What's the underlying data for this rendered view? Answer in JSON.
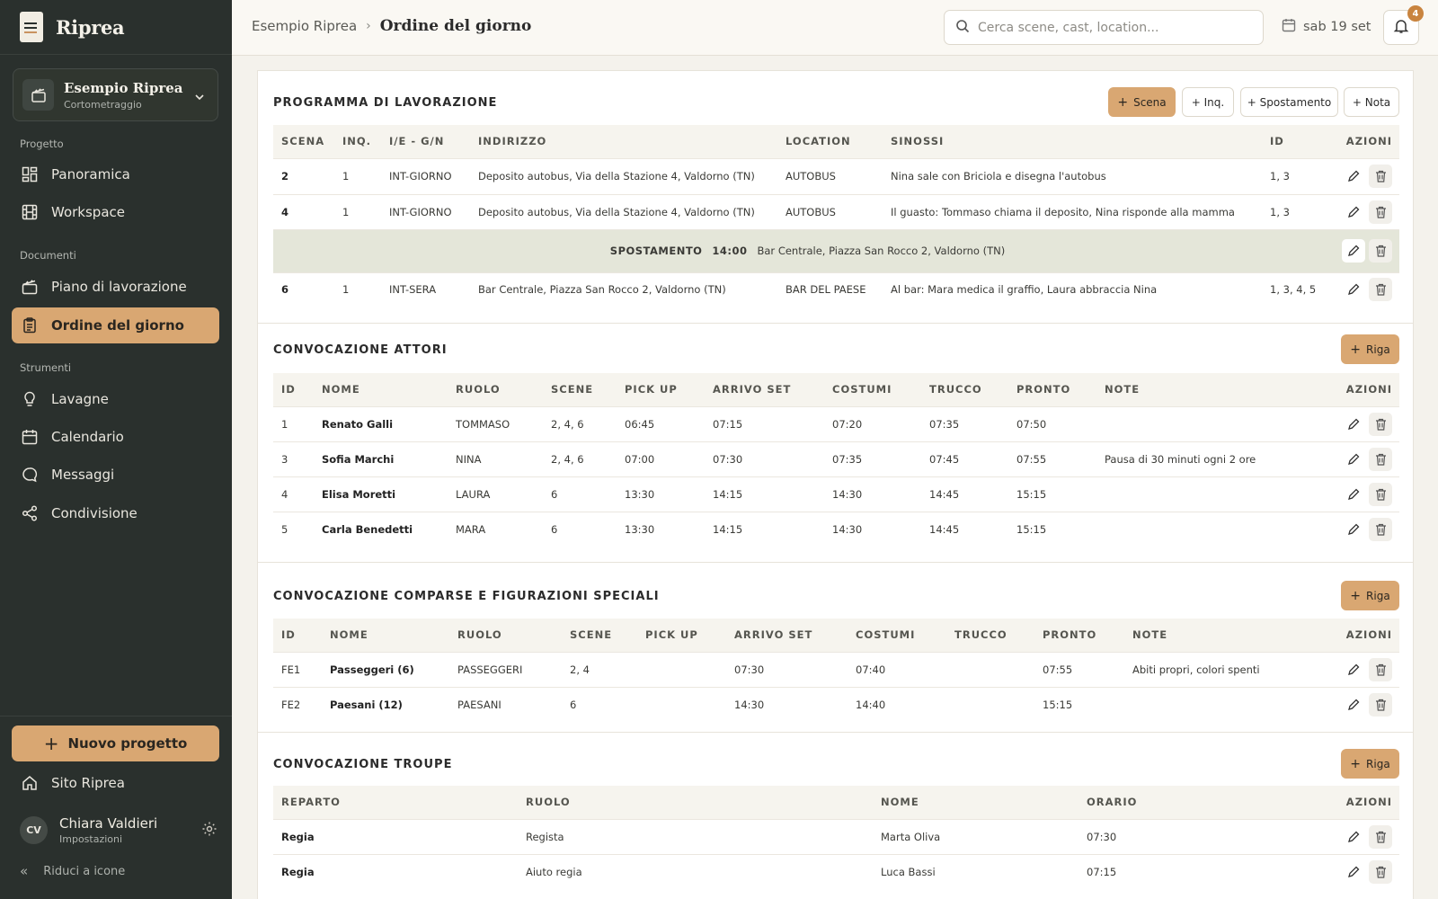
{
  "app": {
    "name": "Riprea"
  },
  "project": {
    "name": "Esempio Riprea",
    "type": "Cortometraggio"
  },
  "sidebar": {
    "sections": {
      "progetto": "Progetto",
      "documenti": "Documenti",
      "strumenti": "Strumenti"
    },
    "items": [
      {
        "label": "Panoramica",
        "icon": "grid-icon"
      },
      {
        "label": "Workspace",
        "icon": "film-icon"
      },
      {
        "label": "Piano di lavorazione",
        "icon": "clapper-icon"
      },
      {
        "label": "Ordine del giorno",
        "icon": "clipboard-icon",
        "active": true
      },
      {
        "label": "Lavagne",
        "icon": "lightbulb-icon"
      },
      {
        "label": "Calendario",
        "icon": "calendar-icon"
      },
      {
        "label": "Messaggi",
        "icon": "chat-icon"
      },
      {
        "label": "Condivisione",
        "icon": "share-icon"
      }
    ],
    "new_project": "Nuovo progetto",
    "site_link": "Sito Riprea",
    "user": {
      "initials": "CV",
      "name": "Chiara Valdieri",
      "sub": "Impostazioni"
    },
    "collapse": "Riduci a icone"
  },
  "topbar": {
    "breadcrumb": {
      "parent": "Esempio Riprea",
      "current": "Ordine del giorno"
    },
    "search_placeholder": "Cerca scene, cast, location...",
    "date": "sab 19 set",
    "notifications": "4"
  },
  "programma": {
    "title": "PROGRAMMA DI LAVORAZIONE",
    "buttons": {
      "scena": "Scena",
      "inq": "+ Inq.",
      "spostamento": "+ Spostamento",
      "nota": "+ Nota"
    },
    "headers": [
      "SCENA",
      "INQ.",
      "I/E - G/N",
      "INDIRIZZO",
      "LOCATION",
      "SINOSSI",
      "ID",
      "AZIONI"
    ],
    "rows": [
      [
        "2",
        "1",
        "INT-GIORNO",
        "Deposito autobus, Via della Stazione 4, Valdorno (TN)",
        "AUTOBUS",
        "Nina sale con Briciola e disegna l'autobus",
        "1, 3"
      ],
      [
        "4",
        "1",
        "INT-GIORNO",
        "Deposito autobus, Via della Stazione 4, Valdorno (TN)",
        "AUTOBUS",
        "Il guasto: Tommaso chiama il deposito, Nina risponde alla mamma",
        "1, 3"
      ]
    ],
    "move": {
      "label": "SPOSTAMENTO",
      "time": "14:00",
      "address": "Bar Centrale, Piazza San Rocco 2, Valdorno (TN)"
    },
    "rows_after": [
      [
        "6",
        "1",
        "INT-SERA",
        "Bar Centrale, Piazza San Rocco 2, Valdorno (TN)",
        "BAR DEL PAESE",
        "Al bar: Mara medica il graffio, Laura abbraccia Nina",
        "1, 3, 4, 5"
      ]
    ]
  },
  "attori": {
    "title": "CONVOCAZIONE ATTORI",
    "add": "Riga",
    "headers": [
      "ID",
      "NOME",
      "RUOLO",
      "SCENE",
      "PICK UP",
      "ARRIVO SET",
      "COSTUMI",
      "TRUCCO",
      "PRONTO",
      "NOTE",
      "AZIONI"
    ],
    "rows": [
      [
        "1",
        "Renato Galli",
        "TOMMASO",
        "2, 4, 6",
        "06:45",
        "07:15",
        "07:20",
        "07:35",
        "07:50",
        ""
      ],
      [
        "3",
        "Sofia Marchi",
        "NINA",
        "2, 4, 6",
        "07:00",
        "07:30",
        "07:35",
        "07:45",
        "07:55",
        "Pausa di 30 minuti ogni 2 ore"
      ],
      [
        "4",
        "Elisa Moretti",
        "LAURA",
        "6",
        "13:30",
        "14:15",
        "14:30",
        "14:45",
        "15:15",
        ""
      ],
      [
        "5",
        "Carla Benedetti",
        "MARA",
        "6",
        "13:30",
        "14:15",
        "14:30",
        "14:45",
        "15:15",
        ""
      ]
    ]
  },
  "comparse": {
    "title": "CONVOCAZIONE COMPARSE E FIGURAZIONI SPECIALI",
    "add": "Riga",
    "headers": [
      "ID",
      "NOME",
      "RUOLO",
      "SCENE",
      "PICK UP",
      "ARRIVO SET",
      "COSTUMI",
      "TRUCCO",
      "PRONTO",
      "NOTE",
      "AZIONI"
    ],
    "rows": [
      [
        "FE1",
        "Passeggeri (6)",
        "PASSEGGERI",
        "2, 4",
        "",
        "07:30",
        "07:40",
        "",
        "07:55",
        "Abiti propri, colori spenti"
      ],
      [
        "FE2",
        "Paesani (12)",
        "PAESANI",
        "6",
        "",
        "14:30",
        "14:40",
        "",
        "15:15",
        ""
      ]
    ]
  },
  "troupe": {
    "title": "CONVOCAZIONE TROUPE",
    "add": "Riga",
    "headers": [
      "REPARTO",
      "RUOLO",
      "NOME",
      "ORARIO",
      "AZIONI"
    ],
    "rows": [
      [
        "Regia",
        "Regista",
        "Marta Oliva",
        "07:30"
      ],
      [
        "Regia",
        "Aiuto regia",
        "Luca Bassi",
        "07:15"
      ]
    ]
  },
  "colors": {
    "sidebar": "#2a302d",
    "accent": "#d9a772",
    "background": "#f4f2ec"
  }
}
